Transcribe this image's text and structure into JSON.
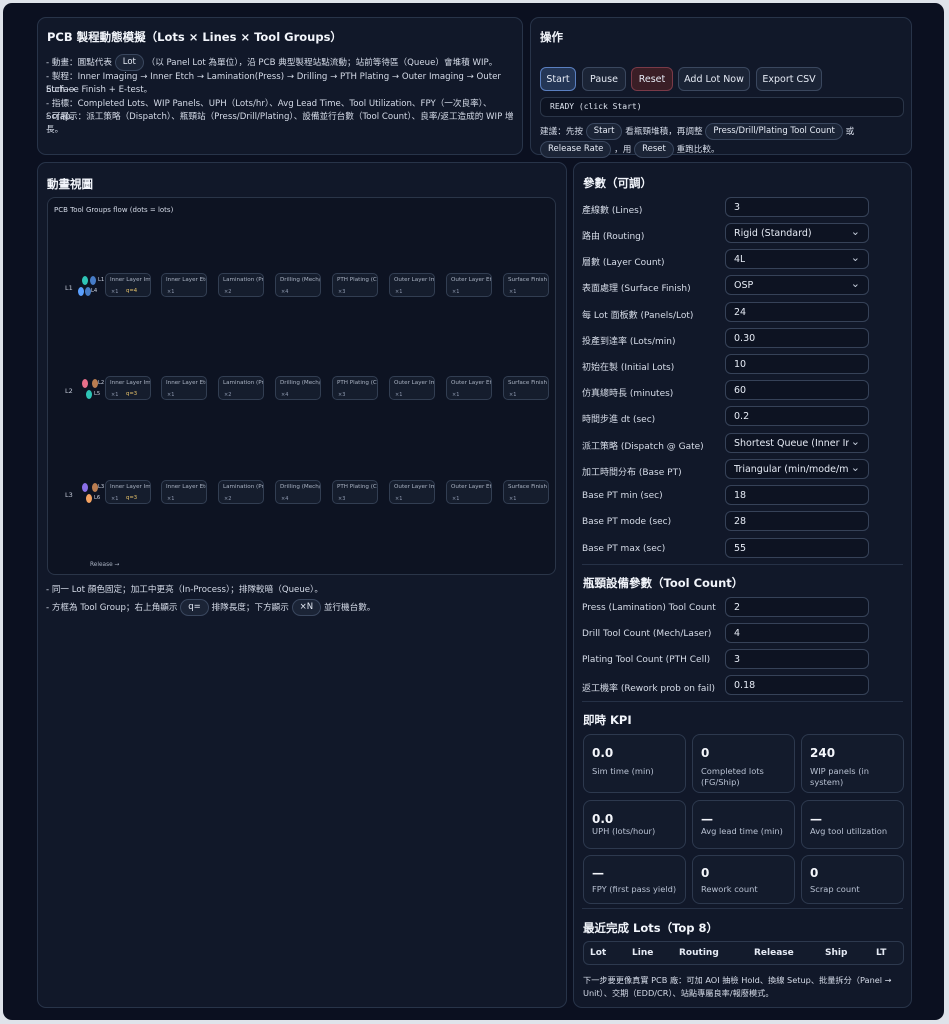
{
  "header": {
    "title": "PCB 製程動態模擬（Lots × Lines × Tool Groups）",
    "line1_a": "- 動畫：圓點代表",
    "line1_pill": "Lot",
    "line1_b": "（以 Panel Lot 為單位），沿 PCB 典型製程站點流動；站前等待區（Queue）會堆積 WIP。",
    "line2": "- 製程：Inner Imaging → Inner Etch → Lamination(Press) → Drilling → PTH Plating → Outer Imaging → Outer Etch →",
    "line3": "Surface Finish + E-test。",
    "line4": "- 指標：Completed Lots、WIP Panels、UPH（Lots/hr）、Avg Lead Time、Tool Utilization、FPY（一次良率）、Scrap。",
    "line5": "- 可展示：派工策略（Dispatch）、瓶頸站（Press/Drill/Plating）、設備並行台數（Tool Count）、良率/返工造成的 WIP 增",
    "line6": "長。"
  },
  "ops": {
    "title": "操作",
    "start": "Start",
    "pause": "Pause",
    "reset": "Reset",
    "add_lot": "Add Lot Now",
    "export": "Export CSV",
    "status": "READY (click Start)",
    "tip_a": "建議：先按",
    "tip_start": "Start",
    "tip_b": "看瓶頸堆積，再調整",
    "tip_tools": "Press/Drill/Plating Tool Count",
    "tip_c": "或",
    "tip_rate": "Release Rate",
    "tip_d": "，用",
    "tip_reset": "Reset",
    "tip_e": "重跑比較。"
  },
  "anim": {
    "title": "動畫視圖",
    "canvas_title": "PCB Tool Groups flow (dots = lots)",
    "release": "Release →",
    "stations": [
      "Inner Layer Imagin...",
      "Inner Layer Etchin...",
      "Lamination (Press)",
      "Drilling (Mech/Las...",
      "PTH Plating (Cu)",
      "Outer Layer Imagin...",
      "Outer Layer Etchin...",
      "Surface Finish + E..."
    ],
    "lines": [
      {
        "name": "L1",
        "counts": [
          "×1",
          "×1",
          "×2",
          "×4",
          "×3",
          "×1",
          "×1",
          "×1"
        ],
        "queue": "q=4",
        "lots": [
          "L1",
          "L4"
        ]
      },
      {
        "name": "L2",
        "counts": [
          "×1",
          "×1",
          "×2",
          "×4",
          "×3",
          "×1",
          "×1",
          "×1"
        ],
        "queue": "q=3",
        "lots": [
          "L2",
          "L5"
        ]
      },
      {
        "name": "L3",
        "counts": [
          "×1",
          "×1",
          "×2",
          "×4",
          "×3",
          "×1",
          "×1",
          "×1"
        ],
        "queue": "q=3",
        "lots": [
          "L3",
          "L6"
        ]
      }
    ],
    "note1": "- 同一 Lot 顏色固定；加工中更亮（In-Process）；排隊較暗（Queue）。",
    "note2_a": "- 方框為 Tool Group；右上角顯示",
    "note2_q": "q=",
    "note2_b": "排隊長度；下方顯示",
    "note2_n": "×N",
    "note2_c": "並行機台數。"
  },
  "params": {
    "title": "參數（可調）",
    "items": [
      {
        "label": "產線數 (Lines)",
        "value": "3",
        "type": "input"
      },
      {
        "label": "路由 (Routing)",
        "value": "Rigid (Standard)",
        "type": "select"
      },
      {
        "label": "層數 (Layer Count)",
        "value": "4L",
        "type": "select"
      },
      {
        "label": "表面處理 (Surface Finish)",
        "value": "OSP",
        "type": "select"
      },
      {
        "label": "每 Lot 面板數 (Panels/Lot)",
        "value": "24",
        "type": "input"
      },
      {
        "label": "投產到達率 (Lots/min)",
        "value": "0.30",
        "type": "input"
      },
      {
        "label": "初始在製 (Initial Lots)",
        "value": "10",
        "type": "input"
      },
      {
        "label": "仿真總時長 (minutes)",
        "value": "60",
        "type": "input"
      },
      {
        "label": "時間步進 dt (sec)",
        "value": "0.2",
        "type": "input"
      },
      {
        "label": "派工策略 (Dispatch @ Gate)",
        "value": "Shortest Queue (Inner Ir",
        "type": "select"
      },
      {
        "label": "加工時間分布 (Base PT)",
        "value": "Triangular (min/mode/m",
        "type": "select"
      },
      {
        "label": "Base PT min (sec)",
        "value": "18",
        "type": "input"
      },
      {
        "label": "Base PT mode (sec)",
        "value": "28",
        "type": "input"
      },
      {
        "label": "Base PT max (sec)",
        "value": "55",
        "type": "input"
      }
    ]
  },
  "tools": {
    "title": "瓶頸設備參數（Tool Count）",
    "items": [
      {
        "label": "Press (Lamination) Tool Count",
        "value": "2"
      },
      {
        "label": "Drill Tool Count (Mech/Laser)",
        "value": "4"
      },
      {
        "label": "Plating Tool Count (PTH Cell)",
        "value": "3"
      },
      {
        "label": "返工機率 (Rework prob on fail)",
        "value": "0.18"
      }
    ]
  },
  "kpi": {
    "title": "即時 KPI",
    "cards": [
      {
        "value": "0.0",
        "label": "Sim time (min)"
      },
      {
        "value": "0",
        "label": "Completed lots (FG/Ship)"
      },
      {
        "value": "240",
        "label": "WIP panels (in system)"
      },
      {
        "value": "0.0",
        "label": "UPH (lots/hour)"
      },
      {
        "value": "—",
        "label": "Avg lead time (min)"
      },
      {
        "value": "—",
        "label": "Avg tool utilization"
      },
      {
        "value": "—",
        "label": "FPY (first pass yield)"
      },
      {
        "value": "0",
        "label": "Rework count"
      },
      {
        "value": "0",
        "label": "Scrap count"
      }
    ]
  },
  "recent": {
    "title": "最近完成 Lots（Top 8）",
    "columns": [
      "Lot",
      "Line",
      "Routing",
      "Release",
      "Ship",
      "LT"
    ],
    "footer1": "下一步要更像真實 PCB 廠：可加 AOI 抽檢 Hold、換線 Setup、批量拆分（Panel →",
    "footer2": "Unit）、交期（EDD/CR）、站點專屬良率/報廢模式。"
  },
  "colors": {
    "lot_L1": "#2ec4b6",
    "lot_L2": "#e76f8a",
    "lot_L3": "#8a6fe8",
    "lot_L4": "#5aa0ff",
    "lot_L5": "#2ec4b6",
    "lot_L6": "#f4a261",
    "queue": "#e9c46a"
  }
}
